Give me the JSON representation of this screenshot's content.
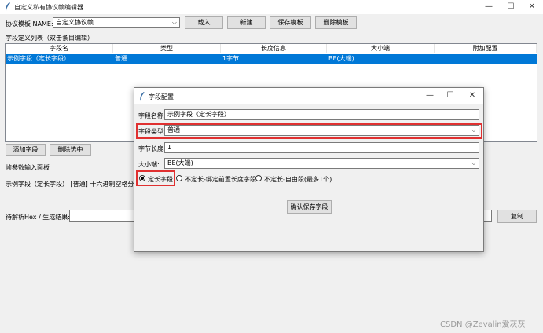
{
  "window": {
    "title": "自定义私有协议帧编辑器",
    "minimize": "—",
    "maximize": "☐",
    "close": "✕"
  },
  "toolbar": {
    "template_label": "协议模板 NAME:",
    "template_value": "自定义协议帧",
    "load": "载入",
    "new": "新建",
    "save": "保存模板",
    "delete": "删除模板"
  },
  "fields_list": {
    "heading": "字段定义列表（双击条目编辑）",
    "columns": [
      "字段名",
      "类型",
      "长度信息",
      "大小端",
      "附加配置"
    ],
    "rows": [
      [
        "示例字段（定长字段）",
        "普通",
        "1字节",
        "BE(大端)",
        ""
      ]
    ]
  },
  "actions": {
    "add": "添加字段",
    "delete_selected": "删除选中"
  },
  "panel": {
    "heading": "帧参数输入面板",
    "row_text": "示例字段（定长字段） [普通] 十六进制空格分隔"
  },
  "hex": {
    "label": "待解析Hex / 生成结果:",
    "value": "",
    "copy": "复制"
  },
  "dialog": {
    "title": "字段配置",
    "name_label": "字段名称:",
    "name_value": "示例字段（定长字段）",
    "type_label": "字段类型:",
    "type_value": "普通",
    "len_label": "字节长度:",
    "len_value": "1",
    "endian_label": "大小端:",
    "endian_value": "BE(大端)",
    "radio_fixed": "定长字段",
    "radio_bound": "不定长-绑定前置长度字段",
    "radio_free": "不定长-自由段(最多1个)",
    "confirm": "确认保存字段"
  },
  "watermark": "CSDN @Zevalin爱灰灰"
}
